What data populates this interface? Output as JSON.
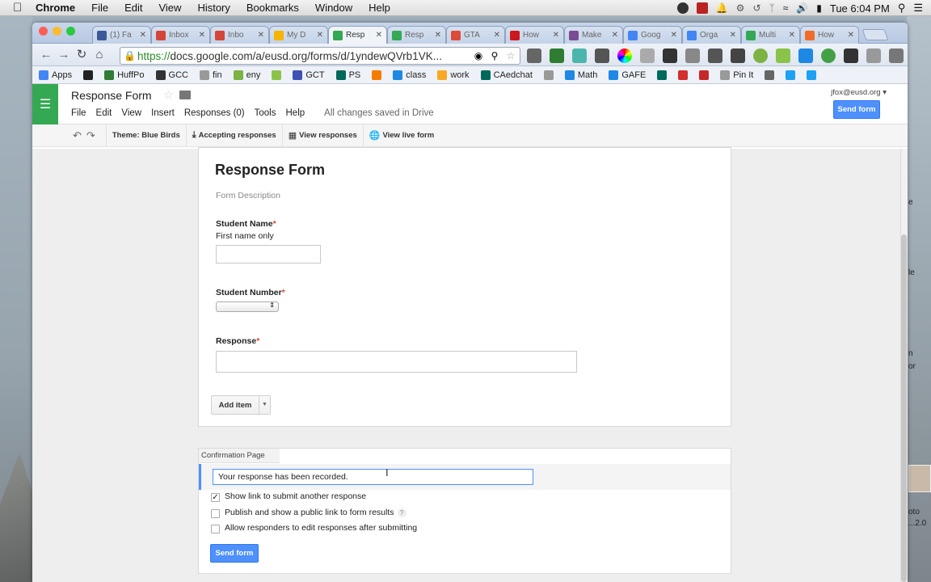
{
  "os_menu": {
    "app": "Chrome",
    "items": [
      "File",
      "Edit",
      "View",
      "History",
      "Bookmarks",
      "Window",
      "Help"
    ],
    "clock": "Tue 6:04 PM"
  },
  "browser": {
    "tabs": [
      {
        "label": "(1) Fa",
        "color": "#3b5998",
        "active": false
      },
      {
        "label": "Inbox",
        "color": "#d44638",
        "active": false
      },
      {
        "label": "Inbo",
        "color": "#d44638",
        "active": false
      },
      {
        "label": "My D",
        "color": "#f4b400",
        "active": false
      },
      {
        "label": "Resp",
        "color": "#34a853",
        "active": true
      },
      {
        "label": "Resp",
        "color": "#34a853",
        "active": false
      },
      {
        "label": "GTA",
        "color": "#dd4b39",
        "active": false
      },
      {
        "label": "How",
        "color": "#cc181e",
        "active": false
      },
      {
        "label": "Make",
        "color": "#7b4b94",
        "active": false
      },
      {
        "label": "Goog",
        "color": "#4285f4",
        "active": false
      },
      {
        "label": "Orga",
        "color": "#4285f4",
        "active": false
      },
      {
        "label": "Multi",
        "color": "#34a853",
        "active": false
      },
      {
        "label": "How",
        "color": "#f06c28",
        "active": false
      }
    ],
    "url_https": "https://",
    "url_rest": "docs.google.com/a/eusd.org/forms/d/1yndewQVrb1VK...",
    "bookmarks": [
      {
        "label": "Apps",
        "color": "#4285f4"
      },
      {
        "label": "",
        "color": "#222"
      },
      {
        "label": "HuffPo",
        "color": "#2e7d32"
      },
      {
        "label": "GCC",
        "color": "#333"
      },
      {
        "label": "fin",
        "color": "#999"
      },
      {
        "label": "eny",
        "color": "#7cb342"
      },
      {
        "label": "",
        "color": "#8bc34a"
      },
      {
        "label": "GCT",
        "color": "#3f51b5"
      },
      {
        "label": "PS",
        "color": "#00695c"
      },
      {
        "label": "",
        "color": "#f57c00"
      },
      {
        "label": "class",
        "color": "#1e88e5"
      },
      {
        "label": "work",
        "color": "#f9a825"
      },
      {
        "label": "CAedchat",
        "color": "#00695c"
      },
      {
        "label": "",
        "color": "#999"
      },
      {
        "label": "Math",
        "color": "#1e88e5"
      },
      {
        "label": "GAFE",
        "color": "#1e88e5"
      },
      {
        "label": "",
        "color": "#00695c"
      },
      {
        "label": "",
        "color": "#d32f2f"
      },
      {
        "label": "",
        "color": "#c62828"
      },
      {
        "label": "Pin It",
        "color": "#999"
      },
      {
        "label": "",
        "color": "#666"
      },
      {
        "label": "",
        "color": "#1da1f2"
      },
      {
        "label": "",
        "color": "#1da1f2"
      }
    ]
  },
  "forms": {
    "doc_title": "Response Form",
    "menu": [
      "File",
      "Edit",
      "View",
      "Insert",
      "Responses (0)",
      "Tools",
      "Help"
    ],
    "saved_status": "All changes saved in Drive",
    "account": "jfox@eusd.org",
    "send_form": "Send form",
    "toolbar": {
      "theme": "Theme: Blue Birds",
      "accepting": "Accepting responses",
      "view_responses": "View responses",
      "view_live": "View live form"
    }
  },
  "form": {
    "title": "Response Form",
    "description": "Form Description",
    "questions": [
      {
        "label": "Student Name",
        "required": "*",
        "help": "First name only"
      },
      {
        "label": "Student Number",
        "required": "*"
      },
      {
        "label": "Response",
        "required": "*"
      }
    ],
    "add_item": "Add item"
  },
  "confirmation": {
    "tab": "Confirmation Page",
    "message": "Your response has been recorded.",
    "options": [
      {
        "label": "Show link to submit another response",
        "checked": true
      },
      {
        "label": "Publish and show a public link to form results",
        "checked": false
      },
      {
        "label": "Allow responders to edit responses after submitting",
        "checked": false
      }
    ],
    "send_form": "Send form"
  },
  "desktop": {
    "labels": [
      "e",
      "le",
      "n",
      "or",
      "oto",
      "...2.0"
    ]
  }
}
